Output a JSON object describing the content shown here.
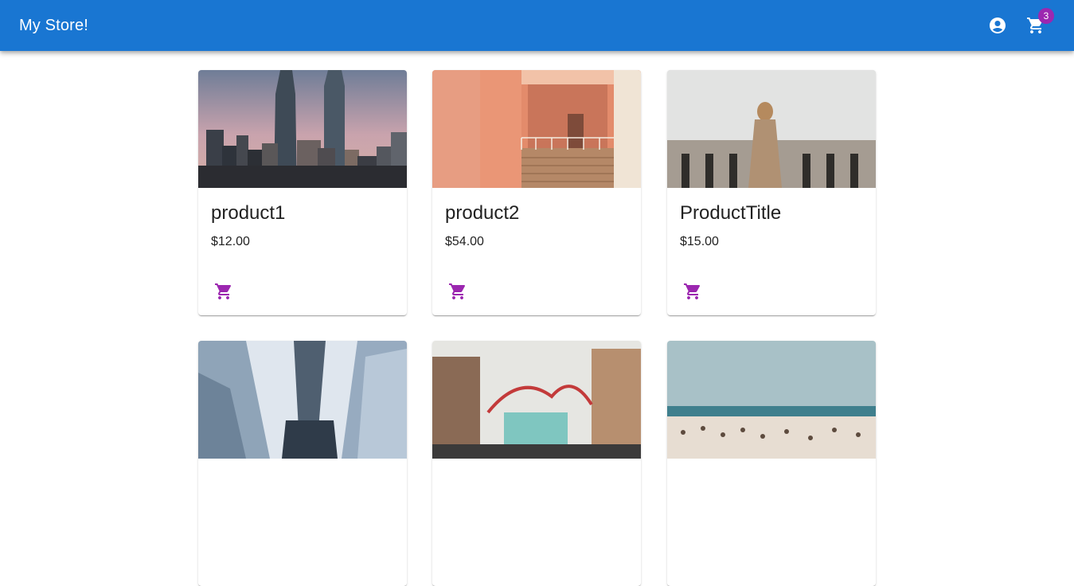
{
  "header": {
    "title": "My Store!",
    "account_icon": "account-circle-icon",
    "cart_icon": "shopping-cart-icon",
    "cart_count": "3",
    "bar_color": "#1976d2",
    "badge_color": "#9c27b0"
  },
  "products": [
    {
      "title": "product1",
      "price": "$12.00",
      "image": "city-skyline-photo",
      "cart_icon": "add-shopping-cart-icon"
    },
    {
      "title": "product2",
      "price": "$54.00",
      "image": "orange-balcony-photo",
      "cart_icon": "add-shopping-cart-icon"
    },
    {
      "title": "ProductTitle",
      "price": "$15.00",
      "image": "woman-at-railing-photo",
      "cart_icon": "add-shopping-cart-icon"
    },
    {
      "image": "skyscrapers-looking-up-photo"
    },
    {
      "image": "amusement-park-street-photo"
    },
    {
      "image": "beach-crowd-photo"
    }
  ],
  "accent_color": "#9c27b0"
}
